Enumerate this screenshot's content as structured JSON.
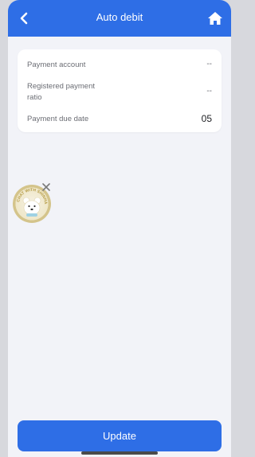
{
  "header": {
    "title": "Auto debit",
    "back_icon": "chevron-left-icon",
    "home_icon": "home-icon",
    "color": "#2e6ee6"
  },
  "details": {
    "payment_account_label": "Payment account",
    "payment_account_value": "--",
    "registered_ratio_label": "Registered payment ratio",
    "registered_ratio_value": "--",
    "due_date_label": "Payment due date",
    "due_date_value": "05"
  },
  "floating_widget": {
    "badge_text": "CHAT WITH SHINHAN",
    "icon": "bear-mascot-icon",
    "close_icon": "close-icon"
  },
  "footer": {
    "update_label": "Update"
  }
}
